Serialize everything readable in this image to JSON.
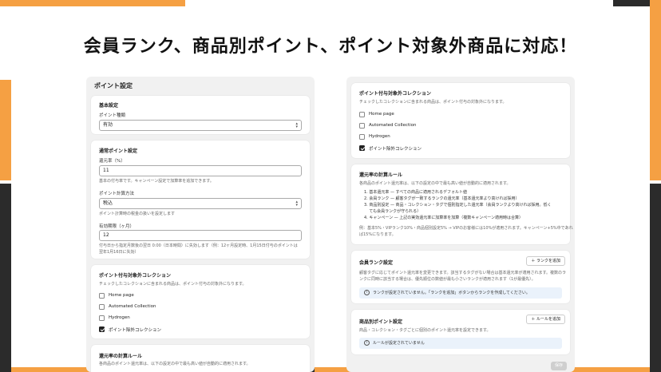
{
  "headline": "会員ランク、商品別ポイント、ポイント対象外商品に対応！",
  "left": {
    "title": "ポイント設定",
    "basic": {
      "title": "基本設定",
      "type_label": "ポイント種類",
      "type_value": "有効",
      "arrow_icon": "select-chevron-icon"
    },
    "normal": {
      "title": "通常ポイント設定",
      "rate_label": "還元率（%）",
      "rate_value": "11",
      "rate_help": "基本の付与率です。キャンペーン設定で加算率を追加できます。",
      "calc_label": "ポイント計算方法",
      "calc_value": "税込",
      "calc_help": "ポイント計算時の税金の扱いを設定します",
      "expiry_label": "有効期限（ヶ月）",
      "expiry_value": "12",
      "expiry_help_1": "付与日から指定月数後の翌日 0:00（日本時間）に失効します（例：12ヶ月設定時、1月15日付与のポイントは",
      "expiry_help_2": "翌年1月16日に失効）"
    },
    "excluded": {
      "title": "ポイント付与対象外コレクション",
      "description": "チェックしたコレクションに含まれる商品は、ポイント付与の対象外になります。",
      "items": [
        {
          "label": "Home page",
          "checked": false
        },
        {
          "label": "Automated Collection",
          "checked": false
        },
        {
          "label": "Hydrogen",
          "checked": false
        },
        {
          "label": "ポイント除外コレクション",
          "checked": true
        }
      ]
    },
    "rules": {
      "title": "還元率の計算ルール",
      "description": "各商品のポイント還元率は、以下の設定の中で最も高い値が自動的に適用されます。"
    }
  },
  "right": {
    "excluded": {
      "title": "ポイント付与対象外コレクション",
      "description": "チェックしたコレクションに含まれる商品は、ポイント付与の対象外になります。",
      "items": [
        {
          "label": "Home page",
          "checked": false
        },
        {
          "label": "Automated Collection",
          "checked": false
        },
        {
          "label": "Hydrogen",
          "checked": false
        },
        {
          "label": "ポイント除外コレクション",
          "checked": true
        }
      ]
    },
    "rules": {
      "title": "還元率の計算ルール",
      "description": "各商品のポイント還元率は、以下の設定の中で最も高い値が自動的に適用されます。",
      "items": [
        "1. 基本還元率 — すべての商品に適用されるデフォルト値",
        "2. 会員ランク — 顧客タグが一致するランクの還元率（基本還元率より高ければ採用）",
        "3. 商品別設定 — 商品・コレクション・タグで個別指定した還元率（会員ランクより高ければ採用。低く",
        "    ても会員ランクが守られる）",
        "4. キャンペーン — 上記の実効還元率に加算率を加算（複数キャンペーン適用時は合算）"
      ],
      "example_1": "例：基本5%・VIPランク10%・商品個別設定5% → VIPのお客様には10%が適用されます。キャンペーン+5%中であれ",
      "example_2": "ば15%になります。"
    },
    "rank": {
      "title": "会員ランク設定",
      "add_button": "＋ ランクを追加",
      "description_1": "顧客タグに応じてポイント還元率を変更できます。該当するタグがない場合は基本還元率が適用されます。複数のラ",
      "description_2": "ンクに同時に該当する場合は、優先順位の数値が最も小さいランクが適用されます（1が最優先）。",
      "info_icon": "info-icon",
      "info": "ランクが設定されていません。「ランクを追加」ボタンからランクを作成してください。"
    },
    "product": {
      "title": "商品別ポイント設定",
      "add_button": "＋ ルールを追加",
      "description": "商品・コレクション・タグごとに個別のポイント還元率を設定できます。",
      "info_icon": "info-icon",
      "info": "ルールが設定されていません"
    },
    "save_label": "保存"
  }
}
